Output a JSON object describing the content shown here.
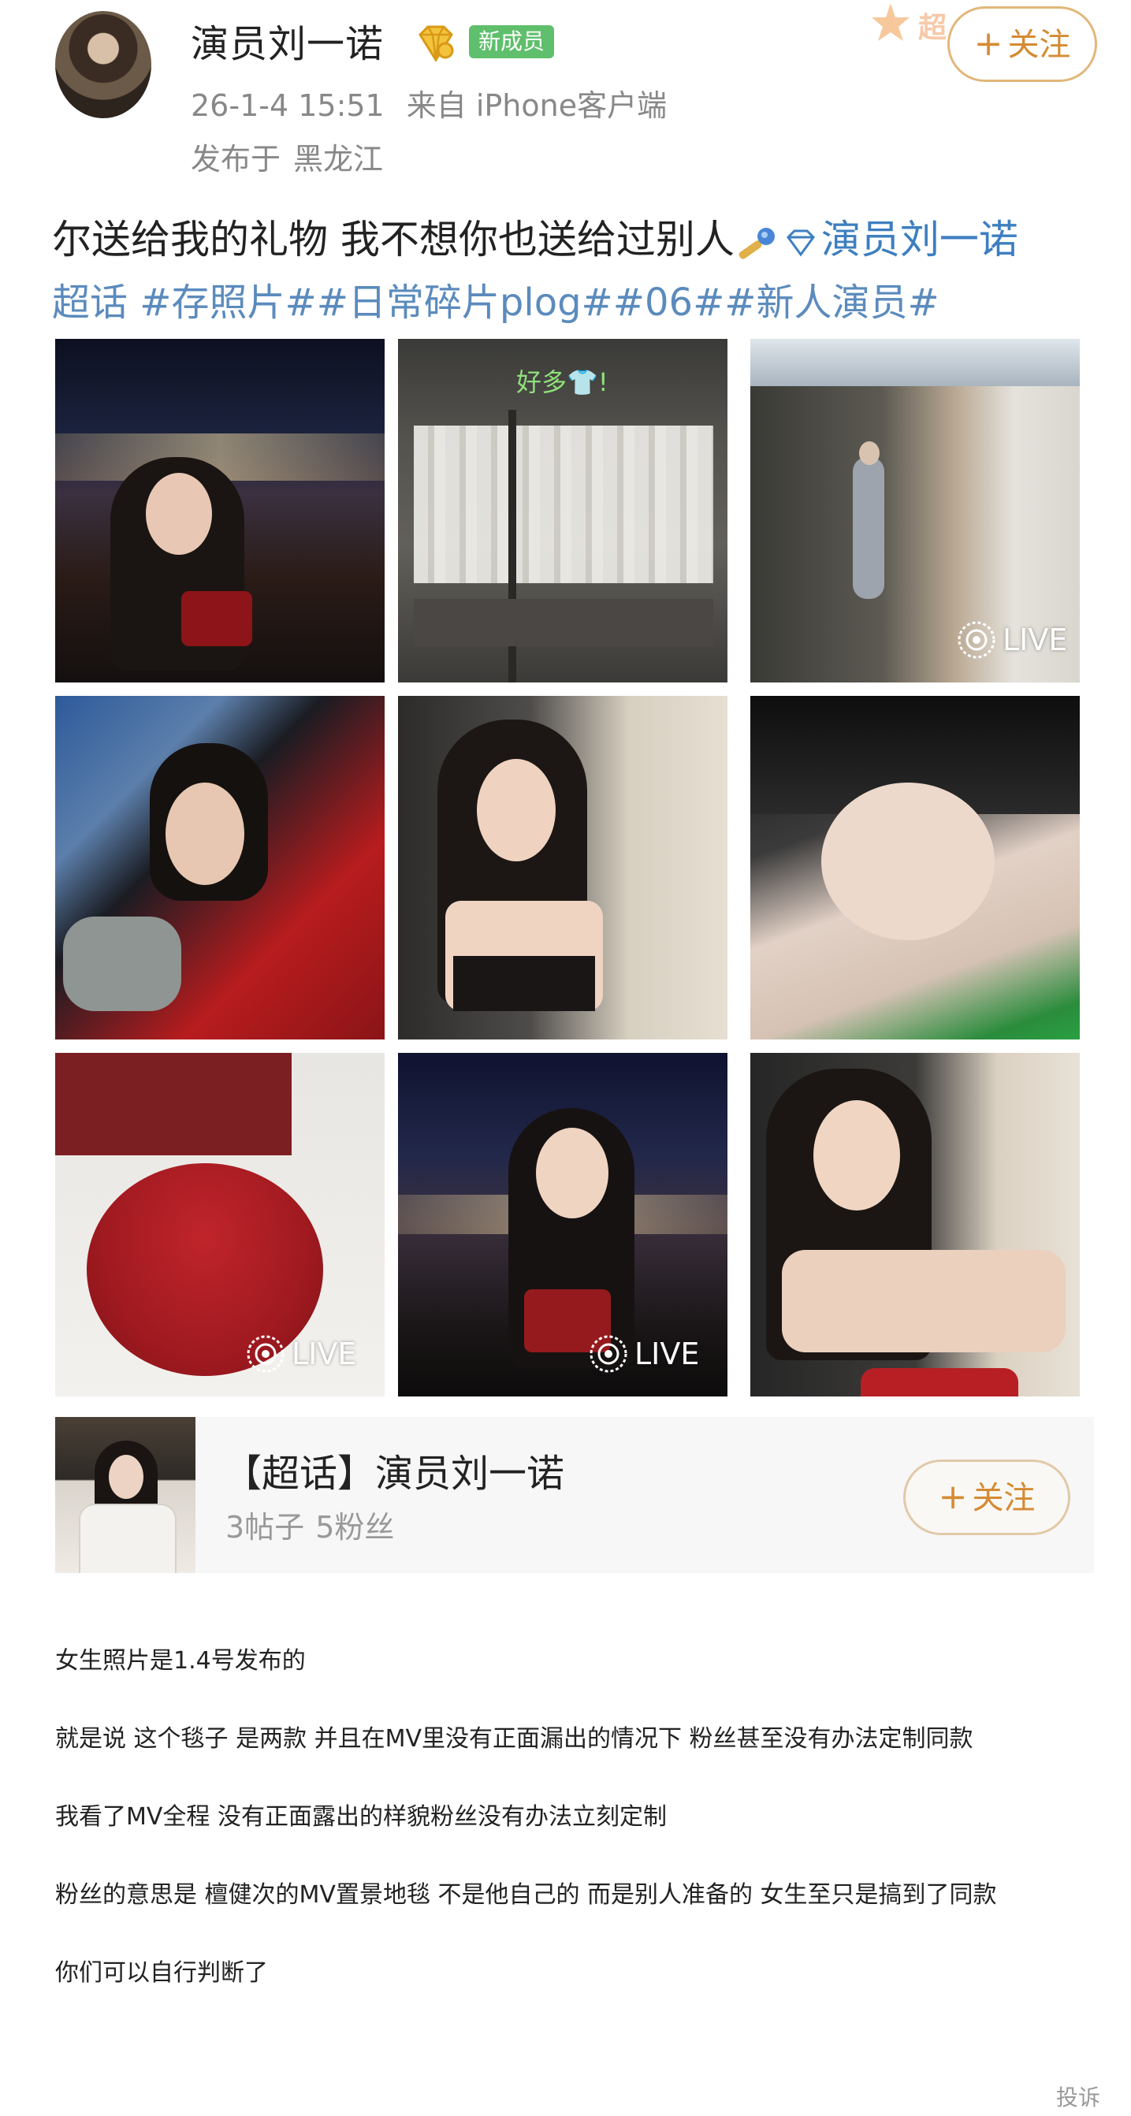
{
  "header": {
    "username": "演员刘一诺",
    "badge": "新成员",
    "super_tag": "超",
    "follow_plus": "+",
    "follow_label": "关注",
    "timestamp": "26-1-4 15:51",
    "source": "来自 iPhone客户端",
    "location_prefix": "发布于",
    "location": "黑龙江"
  },
  "post": {
    "line1_text": "尔送给我的礼物 我不想你也送给过别人",
    "line1_link": "演员刘一诺",
    "line2_text": "超话 #存照片##日常碎片plog##06##新人演员#"
  },
  "photos": {
    "closet_caption": "好多👕!",
    "live_label": "LIVE"
  },
  "topic_card": {
    "title": "【超话】演员刘一诺",
    "posts": "3帖子",
    "fans": "5粉丝",
    "follow_plus": "+",
    "follow_label": "关注"
  },
  "paragraphs": [
    "女生照片是1.4号发布的",
    "就是说 这个毯子  是两款 并且在MV里没有正面漏出的情况下 粉丝甚至没有办法定制同款",
    "我看了MV全程 没有正面露出的样貌粉丝没有办法立刻定制",
    "粉丝的意思是 檀健次的MV置景地毯 不是他自己的 而是别人准备的  女生至只是搞到了同款",
    "你们可以自行判断了"
  ],
  "report_label": "投诉",
  "colors": {
    "link": "#3d7fc0",
    "badge_green": "#5fbf6c",
    "follow_orange": "#d58b33",
    "follow_border": "#e1b77a"
  }
}
